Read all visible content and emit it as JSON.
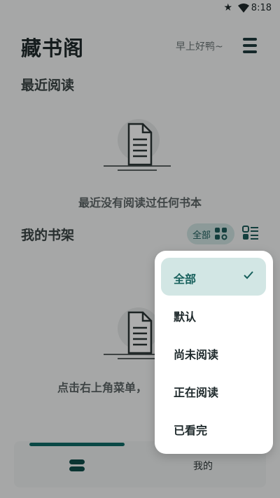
{
  "status_bar": {
    "time": "8:18",
    "icons": [
      "star-icon",
      "wifi-icon",
      "battery-icon"
    ]
  },
  "header": {
    "title": "藏书阁",
    "greeting": "早上好鸭~",
    "menu_icon": "menu-icon"
  },
  "recent": {
    "title": "最近阅读",
    "empty_text": "最近没有阅读过任何书本"
  },
  "shelf": {
    "title": "我的书架",
    "filter_chip_label": "全部",
    "empty_text": "点击右上角菜单，"
  },
  "bottom_nav": {
    "tabs": [
      {
        "icon": "bookshelf-icon",
        "active": true
      },
      {
        "label": "我的"
      }
    ]
  },
  "filter_menu": {
    "options": [
      "全部",
      "默认",
      "尚未阅读",
      "正在阅读",
      "已看完"
    ],
    "selected": "全部"
  },
  "colors": {
    "accent": "#0f6b66",
    "chip_bg": "#cfe4e2",
    "selected_bg": "#d2e6e4"
  }
}
